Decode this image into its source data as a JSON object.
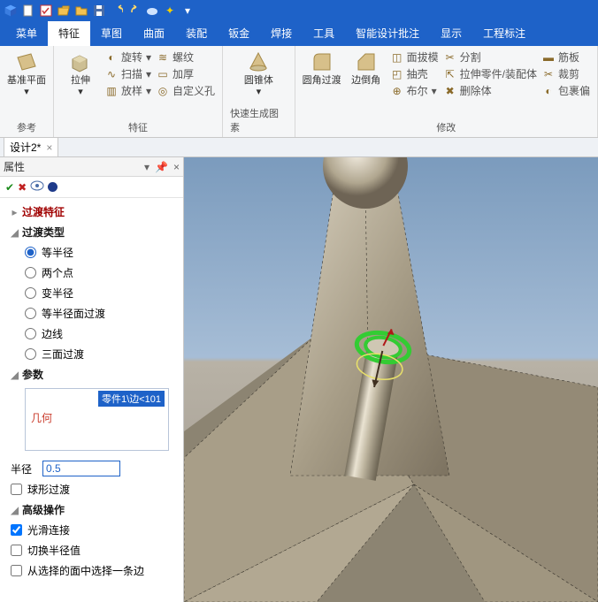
{
  "qat_icons": [
    "app",
    "new",
    "check",
    "open",
    "folder",
    "save",
    "undo",
    "redo",
    "cloud",
    "star",
    "drop"
  ],
  "ribbon_tabs": [
    "菜单",
    "特征",
    "草图",
    "曲面",
    "装配",
    "钣金",
    "焊接",
    "工具",
    "智能设计批注",
    "显示",
    "工程标注"
  ],
  "ribbon_active_tab": 1,
  "groups": {
    "ref": {
      "label": "参考",
      "plane": "基准平面"
    },
    "feature": {
      "label": "特征",
      "extrude": "拉伸",
      "revolve": "旋转",
      "sweep": "扫描",
      "pattern": "放样",
      "thread": "螺纹",
      "thicken": "加厚",
      "custhole": "自定义孔"
    },
    "quick": {
      "label": "快速生成图素",
      "cone": "圆锥体"
    },
    "modify": {
      "label": "修改",
      "fillet": "圆角过渡",
      "chamfer": "边倒角",
      "draft": "面拔模",
      "shell": "抽壳",
      "boolean": "布尔",
      "split": "分割",
      "pullpart": "拉伸零件/装配体",
      "delbody": "删除体",
      "rib": "筋板",
      "trim": "裁剪",
      "wrap": "包裹偏"
    }
  },
  "doc_tab": "设计2*",
  "panel_title": "属性",
  "tree": {
    "top": "过渡特征",
    "type_section": "过渡类型",
    "radios": [
      "等半径",
      "两个点",
      "变半径",
      "等半径面过渡",
      "边线",
      "三面过渡"
    ],
    "radio_selected": 0,
    "param_section": "参数",
    "geom_label": "几何",
    "geom_chip": "零件1\\边<101",
    "radius_label": "半径",
    "radius_value": "0.5",
    "sphere_check": "球形过渡",
    "adv_section": "高级操作",
    "smooth_check": "光滑连接",
    "halfcut_check": "切换半径值",
    "fromface_check": "从选择的面中选择一条边"
  }
}
